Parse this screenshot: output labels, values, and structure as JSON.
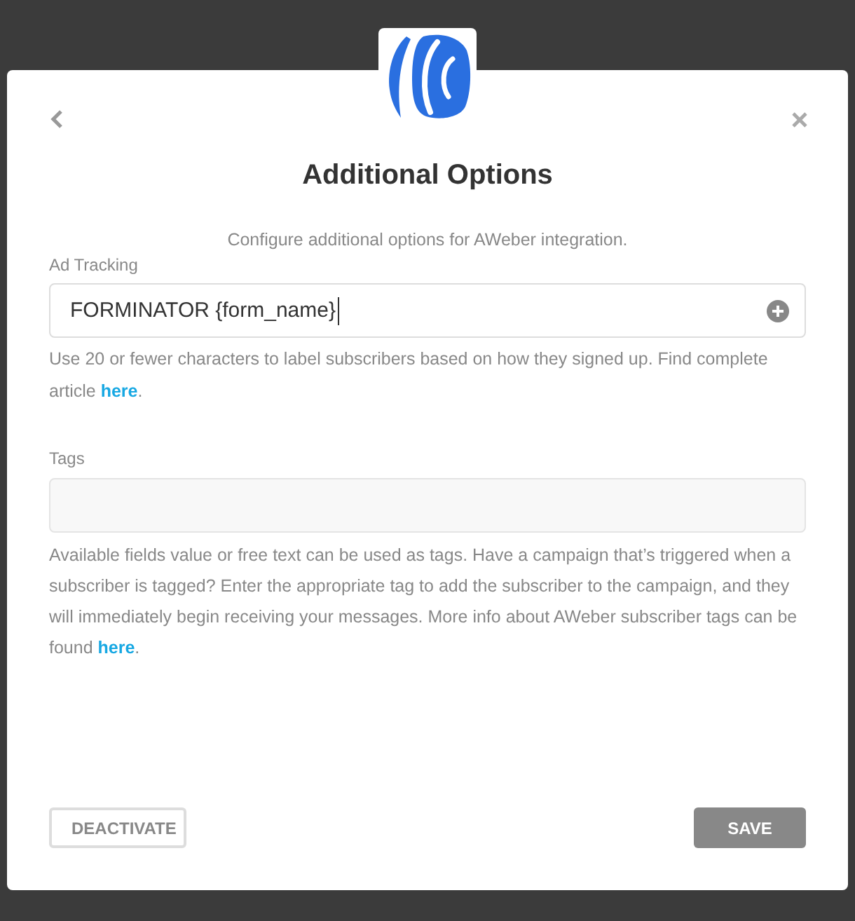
{
  "modal": {
    "title": "Additional Options",
    "subtitle": "Configure additional options for AWeber integration."
  },
  "fields": [
    {
      "kind": "text",
      "label": "Ad Tracking",
      "value": "FORMINATOR {form_name}",
      "focused": true,
      "help": "Use 20 or fewer characters to label subscribers based on how they signed up. Find complete article",
      "link": "here",
      "help_end": "."
    },
    {
      "kind": "tags",
      "label": "Tags",
      "focused": false,
      "help": "Available fields value or free text can be used as tags. Have a campaign that’s triggered when a subscriber is tagged? Enter the appropriate tag to add the subscriber to the campaign, and they will immediately begin receiving your messages. More info about AWeber subscriber tags can be found",
      "link": "here",
      "help_end": "."
    }
  ],
  "buttons": [
    {
      "kind": "outline",
      "label": "DEACTIVATE"
    },
    {
      "kind": "filled",
      "label": "SAVE"
    }
  ]
}
